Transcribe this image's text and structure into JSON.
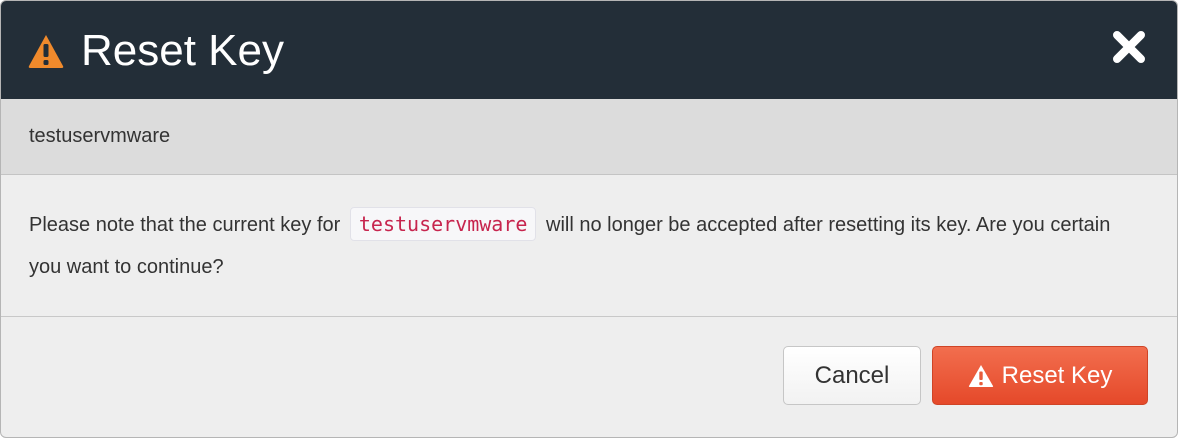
{
  "dialog": {
    "title": "Reset Key",
    "subtitle": "testuservmware",
    "message_before": "Please note that the current key for",
    "message_code": "testuservmware",
    "message_after": "will no longer be accepted after resetting its key. Are you certain you want to continue?"
  },
  "buttons": {
    "cancel_label": "Cancel",
    "reset_label": "Reset Key"
  },
  "icons": {
    "title_icon": "warning-triangle-icon",
    "close_icon": "close-icon",
    "reset_icon": "warning-triangle-icon"
  },
  "colors": {
    "header_bg": "#232e38",
    "warning_orange": "#f08a2c",
    "danger_button": "#e85d3c",
    "code_text": "#c7254e"
  }
}
